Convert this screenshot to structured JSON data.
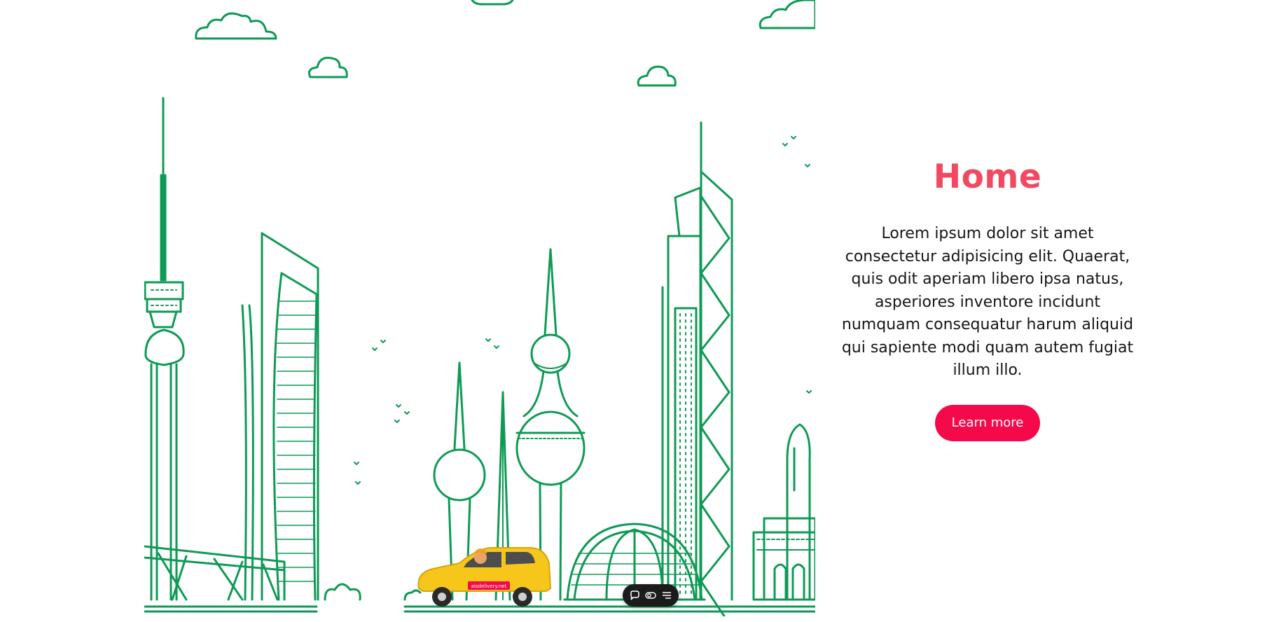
{
  "hero": {
    "title": "Home",
    "description": "Lorem ipsum dolor sit amet consectetur adipisicing elit. Quaerat, quis odit aperiam libero ipsa natus, asperiores inventore incidunt numquam consequatur harum aliquid qui sapiente modi quam autem fugiat illum illo.",
    "button_label": "Learn more"
  },
  "illustration": {
    "car_sign": "aisdelivery.net"
  },
  "toolbar": {
    "icons": [
      "chat-icon",
      "toggle-icon",
      "menu-icon"
    ]
  },
  "colors": {
    "accent": "#f5094a",
    "title": "#f24860",
    "skyline": "#0e9a55",
    "car": "#f7c61b",
    "toolbar": "#1b1b1b"
  }
}
